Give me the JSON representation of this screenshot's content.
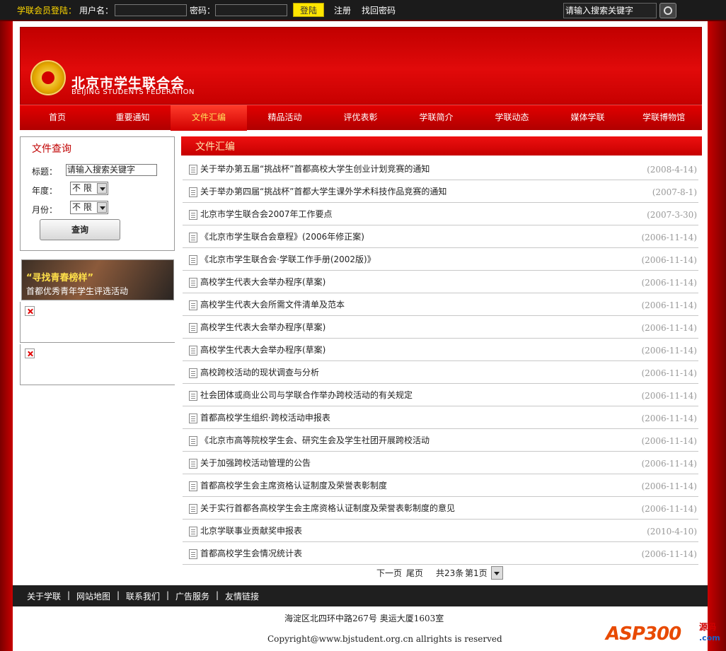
{
  "topbar": {
    "member_label": "学联会员登陆：",
    "username_label": "用户名：",
    "password_label": "密码：",
    "login_button": "登陆",
    "register_link": "注册",
    "find_password_link": "找回密码",
    "search_placeholder": "请输入搜索关键字"
  },
  "banner": {
    "title_cn": "北京市学生联合会",
    "title_en": "BEIJING STUDENTS FEDERATION"
  },
  "nav": {
    "items": [
      "首页",
      "重要通知",
      "文件汇编",
      "精品活动",
      "评优表彰",
      "学联简介",
      "学联动态",
      "媒体学联",
      "学联博物馆"
    ],
    "active": "文件汇编"
  },
  "sidebar": {
    "query_title": "文件查询",
    "title_label": "标题：",
    "title_value": "请输入搜索关键字",
    "year_label": "年度：",
    "year_value": "不 限",
    "month_label": "月份：",
    "month_value": "不 限",
    "query_button": "查询",
    "promo_line1": "“寻找青春榜样”",
    "promo_line2": "首都优秀青年学生评选活动"
  },
  "content": {
    "section_title": "文件汇编",
    "rows": [
      {
        "title": "关于举办第五届“挑战杯”首都高校大学生创业计划竞赛的通知",
        "date": "(2008-4-14)"
      },
      {
        "title": "关于举办第四届“挑战杯”首都大学生课外学术科技作品竞赛的通知",
        "date": "(2007-8-1)"
      },
      {
        "title": "北京市学生联合会2007年工作要点",
        "date": "(2007-3-30)"
      },
      {
        "title": "《北京市学生联合会章程》(2006年修正案)",
        "date": "(2006-11-14)"
      },
      {
        "title": "《北京市学生联合会·学联工作手册(2002版)》",
        "date": "(2006-11-14)"
      },
      {
        "title": "高校学生代表大会举办程序(草案)",
        "date": "(2006-11-14)"
      },
      {
        "title": "高校学生代表大会所需文件清单及范本",
        "date": "(2006-11-14)"
      },
      {
        "title": "高校学生代表大会举办程序(草案)",
        "date": "(2006-11-14)"
      },
      {
        "title": "高校学生代表大会举办程序(草案)",
        "date": "(2006-11-14)"
      },
      {
        "title": "高校跨校活动的现状调查与分析",
        "date": "(2006-11-14)"
      },
      {
        "title": "社会团体或商业公司与学联合作举办跨校活动的有关规定",
        "date": "(2006-11-14)"
      },
      {
        "title": "首都高校学生组织·跨校活动申报表",
        "date": "(2006-11-14)"
      },
      {
        "title": "《北京市高等院校学生会、研究生会及学生社团开展跨校活动",
        "date": "(2006-11-14)"
      },
      {
        "title": "关于加强跨校活动管理的公告",
        "date": "(2006-11-14)"
      },
      {
        "title": "首都高校学生会主席资格认证制度及荣誉表彰制度",
        "date": "(2006-11-14)"
      },
      {
        "title": "关于实行首都各高校学生会主席资格认证制度及荣誉表彰制度的意见",
        "date": "(2006-11-14)"
      },
      {
        "title": "北京学联事业贡献奖申报表",
        "date": "(2010-4-10)"
      },
      {
        "title": "首都高校学生会情况统计表",
        "date": "(2006-11-14)"
      }
    ],
    "pager": {
      "next": "下一页",
      "last": "尾页",
      "total": "共23条",
      "page": "第1页"
    }
  },
  "footer": {
    "links": [
      "关于学联",
      "|",
      "网站地图",
      "|",
      "联系我们",
      "|",
      "广告服务",
      "|",
      "友情链接"
    ],
    "address": "海淀区北四环中路267号 奥运大厦1603室",
    "copyright": "Copyright@www.bjstudent.org.cn allrights is reserved",
    "watermark_main": "ASP300",
    "watermark_side": "源码",
    "watermark_com": ".com"
  },
  "colors": {
    "brand_red": "#d40000",
    "nav_active_text": "#ffe25c",
    "login_button_bg": "#ffe600"
  }
}
